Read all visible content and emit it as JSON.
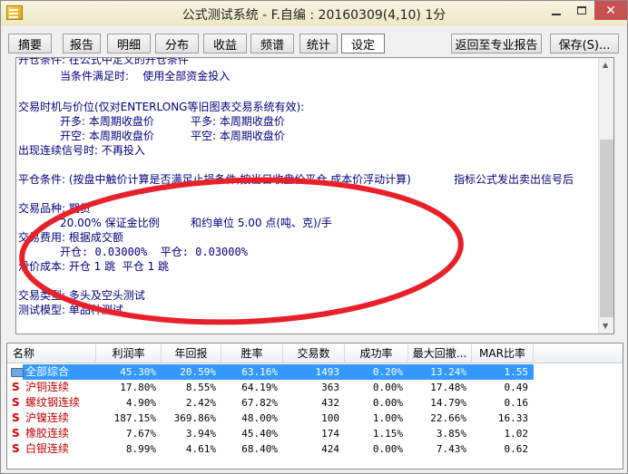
{
  "window": {
    "title": "公式测试系统 - F.自编 : 20160309(4,10) 1分",
    "close_glyph": "✕"
  },
  "toolbar": {
    "tabs": [
      "摘要",
      "报告",
      "明细",
      "分布",
      "收益",
      "频谱",
      "统计",
      "设定"
    ],
    "back_label": "返回至专业报告",
    "save_label": "保存(S)..."
  },
  "report": {
    "lines": [
      "开仓条件: 在公式中定义的开仓条件",
      "当条件满足时:    使用全部资金投入",
      "交易时机与价位(仅对ENTERLONG等旧图表交易系统有效):",
      "开多: 本周期收盘价",
      "平多: 本周期收盘价",
      "开空: 本周期收盘价",
      "平空: 本周期收盘价",
      "出现连续信号时: 不再投入",
      "平仓条件: (按盘中触价计算是否满足止损条件,按当日收盘价平仓,成本价浮动计算)",
      "指标公式发出卖出信号后",
      "交易品种: 期货",
      "20.00% 保证金比例",
      "和约单位 5.00 点(吨、克)/手",
      "交易费用: 根据成交额",
      "开仓: 0.03000%  平仓: 0.03000%",
      "滑价成本: 开仓 1 跳  平仓 1 跳",
      "交易类型: 多头及空头测试",
      "测试模型: 单品种测试"
    ],
    "annotation_color": "#e8202a"
  },
  "table": {
    "columns": [
      "名称",
      "利润率",
      "年回报",
      "胜率",
      "交易数",
      "成功率",
      "最大回撤...",
      "MAR比率"
    ],
    "rows": [
      {
        "icon": "folder",
        "name": "全部综合",
        "cells": [
          "45.30%",
          "20.59%",
          "63.16%",
          "1493",
          "0.20%",
          "13.24%",
          "1.55"
        ]
      },
      {
        "icon": "S",
        "name": "沪铜连续",
        "cells": [
          "17.80%",
          "8.55%",
          "64.19%",
          "363",
          "0.00%",
          "17.48%",
          "0.49"
        ]
      },
      {
        "icon": "S",
        "name": "螺纹钢连续",
        "cells": [
          "4.90%",
          "2.42%",
          "67.82%",
          "432",
          "0.00%",
          "14.79%",
          "0.16"
        ]
      },
      {
        "icon": "S",
        "name": "沪镍连续",
        "cells": [
          "187.15%",
          "369.86%",
          "48.00%",
          "100",
          "1.00%",
          "22.66%",
          "16.33"
        ]
      },
      {
        "icon": "S",
        "name": "橡胶连续",
        "cells": [
          "7.67%",
          "3.94%",
          "45.40%",
          "174",
          "1.15%",
          "3.85%",
          "1.02"
        ]
      },
      {
        "icon": "S",
        "name": "白银连续",
        "cells": [
          "8.99%",
          "4.61%",
          "68.40%",
          "424",
          "0.00%",
          "7.43%",
          "0.62"
        ]
      }
    ],
    "selection_color": "#3399ff"
  }
}
